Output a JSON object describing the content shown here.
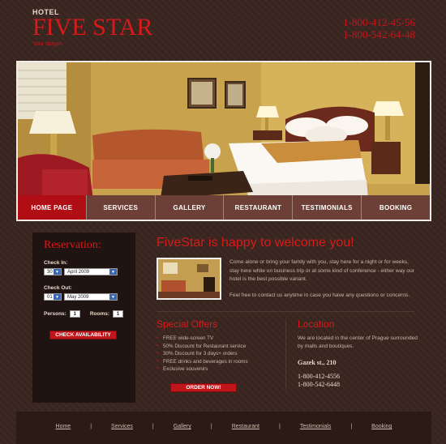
{
  "header": {
    "hotel_label": "HOTEL",
    "title": "FIVE STAR",
    "tagline": "Your slogan",
    "phones": [
      "1-800-412-45-56",
      "1-800-542-64-48"
    ]
  },
  "nav": {
    "items": [
      "HOME PAGE",
      "SERVICES",
      "GALLERY",
      "RESTAURANT",
      "TESTIMONIALS",
      "BOOKING"
    ],
    "active_index": 0
  },
  "reservation": {
    "title": "Reservation:",
    "check_in_label": "Check In:",
    "check_in_day": "30",
    "check_in_month": "April 2009",
    "check_out_label": "Check Out:",
    "check_out_day": "01",
    "check_out_month": "May 2009",
    "persons_label": "Persons:",
    "persons_value": "1",
    "rooms_label": "Rooms:",
    "rooms_value": "1",
    "button": "CHECK AVAILABILITY"
  },
  "welcome": {
    "title": "FiveStar is happy to welcome you!",
    "paragraph1": "Come alone or bring your family with you, stay here for a night or for weeks, stay here while on business trip or at some kind of conference - either way our hotel is the best possible variant.",
    "paragraph2": "Feel free to contact us anytime in case you have any questions or concerns."
  },
  "offers": {
    "title": "Special Offers",
    "items": [
      "FREE wide-screen TV",
      "50% Discount for Restaurant service",
      "30% Discount for 3 days+ orders",
      "FREE drinks and beverages in rooms",
      "Exclusive souvenirs"
    ],
    "button": "ORDER NOW!"
  },
  "location": {
    "title": "Location",
    "text": "We are located in the center of Prague surrounded by malls and boutiques.",
    "address": "Gazek st., 210",
    "phones": [
      "1-800-412-4556",
      "1-800-542-6448"
    ]
  },
  "footer": {
    "links": [
      "Home",
      "Services",
      "Gallery",
      "Restaurant",
      "Testimonials",
      "Booking"
    ]
  },
  "colors": {
    "accent": "#d81a1a",
    "background": "#3a2620",
    "panel": "#1f1411"
  }
}
